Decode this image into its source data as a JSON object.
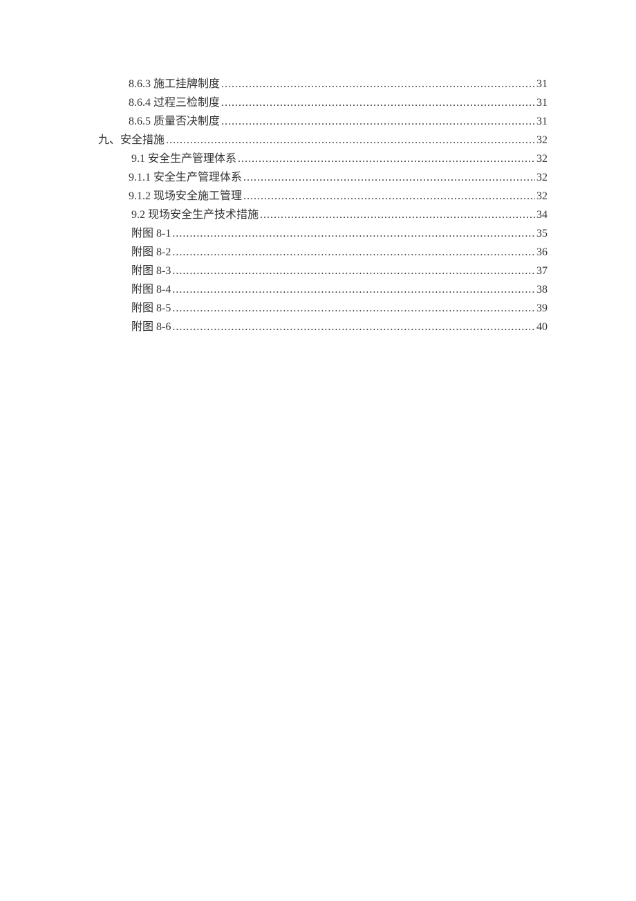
{
  "toc": [
    {
      "level": 3,
      "label": "8.6.3 施工挂牌制度",
      "page": "31"
    },
    {
      "level": 3,
      "label": "8.6.4 过程三检制度",
      "page": "31"
    },
    {
      "level": 3,
      "label": "8.6.5 质量否决制度",
      "page": "31"
    },
    {
      "level": 1,
      "label": "九、安全措施",
      "page": "32"
    },
    {
      "level": 2,
      "label": "9.1 安全生产管理体系",
      "page": "32"
    },
    {
      "level": 3,
      "label": "9.1.1 安全生产管理体系",
      "page": "32"
    },
    {
      "level": 3,
      "label": "9.1.2 现场安全施工管理",
      "page": "32"
    },
    {
      "level": 2,
      "label": "9.2 现场安全生产技术措施",
      "page": "34"
    },
    {
      "level": 2,
      "label": "附图 8-1",
      "page": "35"
    },
    {
      "level": 2,
      "label": "附图 8-2",
      "page": "36"
    },
    {
      "level": 2,
      "label": "附图 8-3",
      "page": "37"
    },
    {
      "level": 2,
      "label": "附图 8-4",
      "page": "38"
    },
    {
      "level": 2,
      "label": "附图 8-5",
      "page": "39"
    },
    {
      "level": 2,
      "label": "附图 8-6",
      "page": "40"
    }
  ]
}
